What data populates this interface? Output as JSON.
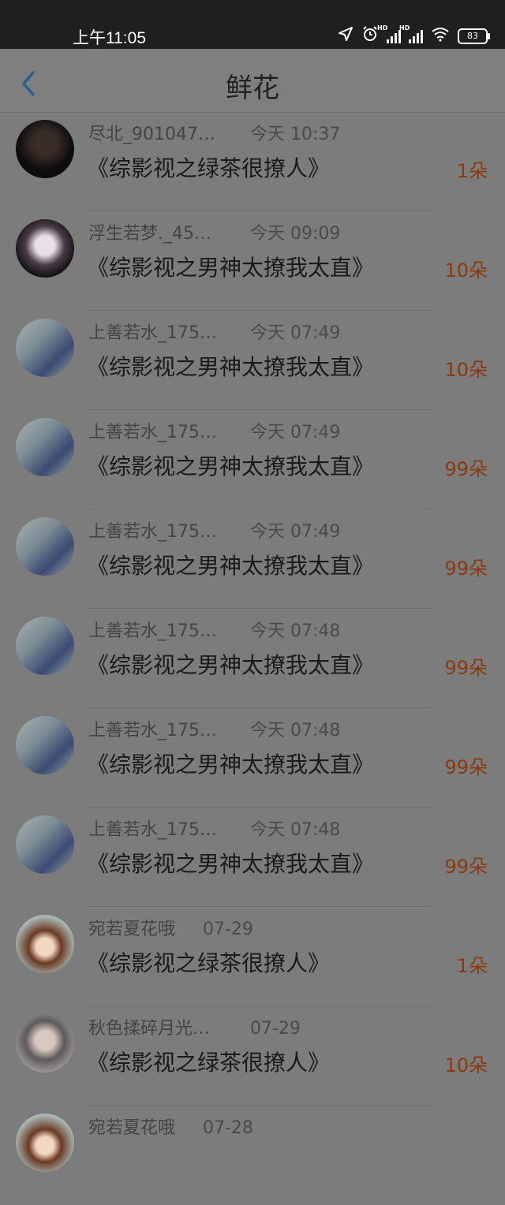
{
  "status_bar": {
    "time": "上午11:05",
    "battery": "83",
    "signal_label_1": "HD",
    "signal_label_2": "HD"
  },
  "header": {
    "title": "鲜花"
  },
  "items": [
    {
      "user": "尽北_901047…",
      "time": "今天 10:37",
      "book": "《综影视之绿茶很撩人》",
      "count": "1朵",
      "avatar": "dark"
    },
    {
      "user": "浮生若梦._45…",
      "time": "今天 09:09",
      "book": "《综影视之男神太撩我太直》",
      "count": "10朵",
      "avatar": "fairy"
    },
    {
      "user": "上善若水_175…",
      "time": "今天 07:49",
      "book": "《综影视之男神太撩我太直》",
      "count": "10朵",
      "avatar": "ink"
    },
    {
      "user": "上善若水_175…",
      "time": "今天 07:49",
      "book": "《综影视之男神太撩我太直》",
      "count": "99朵",
      "avatar": "ink"
    },
    {
      "user": "上善若水_175…",
      "time": "今天 07:49",
      "book": "《综影视之男神太撩我太直》",
      "count": "99朵",
      "avatar": "ink"
    },
    {
      "user": "上善若水_175…",
      "time": "今天 07:48",
      "book": "《综影视之男神太撩我太直》",
      "count": "99朵",
      "avatar": "ink"
    },
    {
      "user": "上善若水_175…",
      "time": "今天 07:48",
      "book": "《综影视之男神太撩我太直》",
      "count": "99朵",
      "avatar": "ink"
    },
    {
      "user": "上善若水_175…",
      "time": "今天 07:48",
      "book": "《综影视之男神太撩我太直》",
      "count": "99朵",
      "avatar": "ink"
    },
    {
      "user": "宛若夏花哦",
      "time": "07-29",
      "book": "《综影视之绿茶很撩人》",
      "count": "1朵",
      "avatar": "girl"
    },
    {
      "user": "秋色揉碎月光…",
      "time": "07-29",
      "book": "《综影视之绿茶很撩人》",
      "count": "10朵",
      "avatar": "grey"
    },
    {
      "user": "宛若夏花哦",
      "time": "07-28",
      "book": "",
      "count": "",
      "avatar": "girl"
    }
  ],
  "icons": {
    "back": "chevron-left-icon",
    "location": "location-arrow-icon",
    "alarm": "alarm-icon",
    "wifi": "wifi-icon"
  }
}
